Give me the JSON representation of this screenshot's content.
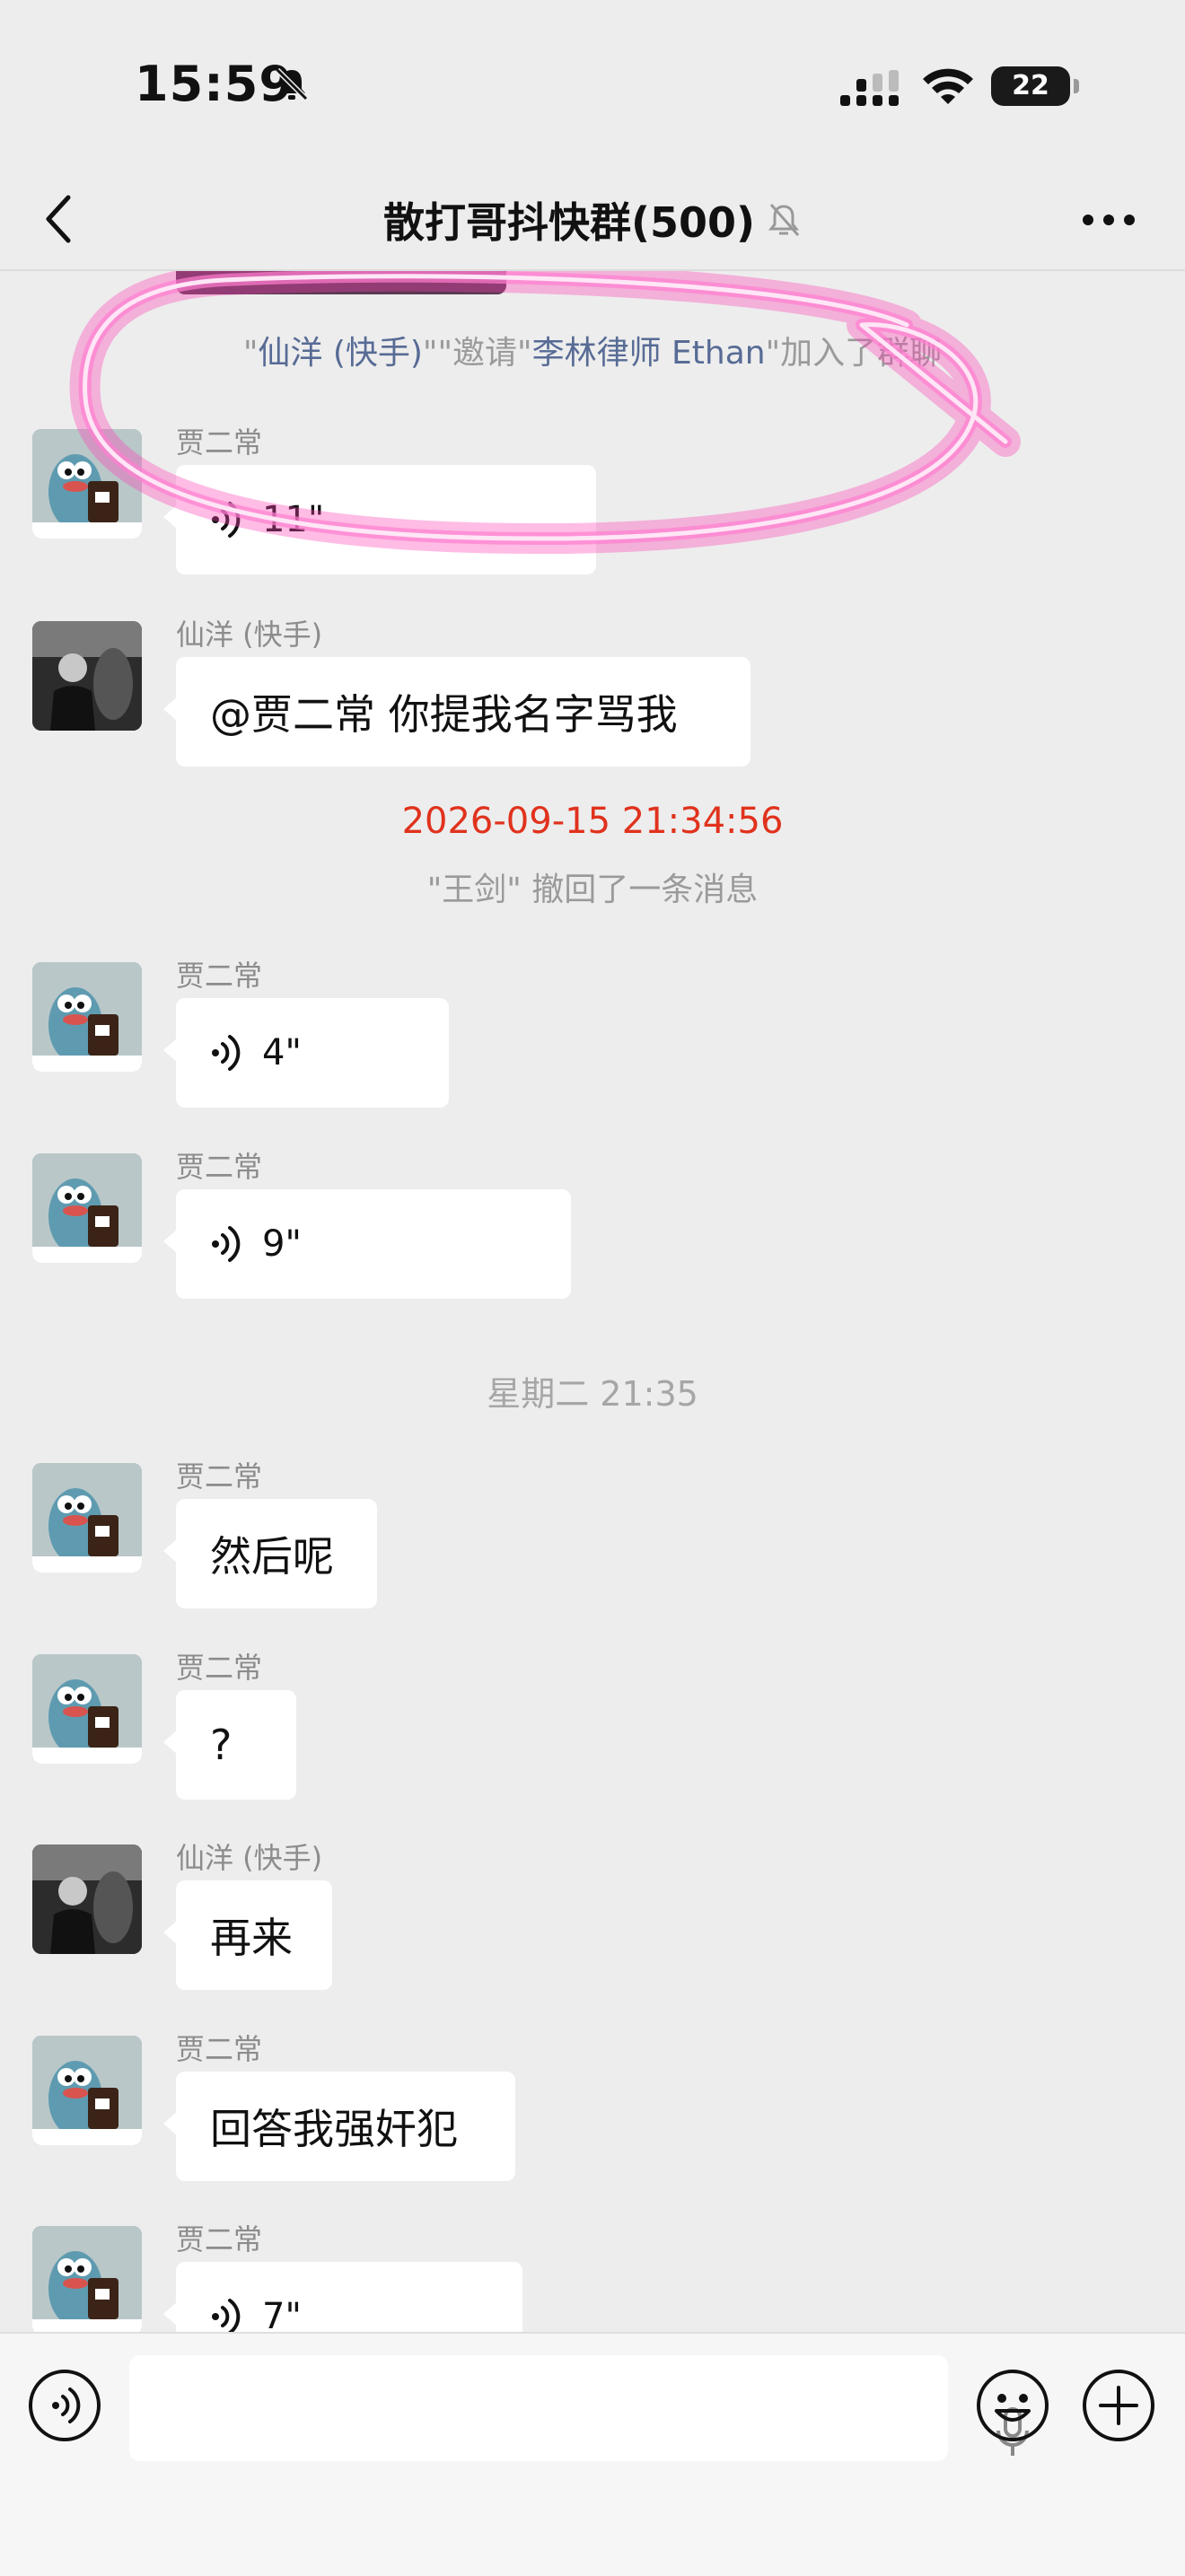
{
  "status_bar": {
    "time": "15:59",
    "battery": "22"
  },
  "nav": {
    "title": "散打哥抖快群(500)"
  },
  "chat": {
    "system_invite": {
      "q1": "\"",
      "inviter": "仙洋 (快手)",
      "q2": "\"",
      "verb": "\"邀请\"",
      "invitee": "李林律师 Ethan",
      "tail": "\"加入了群聊"
    },
    "timestamp_1": "2026-09-15 21:34:56",
    "recall_notice": "\"王剑\" 撤回了一条消息",
    "timestamp_2": "星期二 21:35",
    "messages": [
      {
        "sender": "贾二常",
        "type": "voice",
        "text": "11\""
      },
      {
        "sender": "仙洋 (快手)",
        "type": "text",
        "text": "@贾二常 你提我名字骂我"
      },
      {
        "sender": "贾二常",
        "type": "voice",
        "text": "4\""
      },
      {
        "sender": "贾二常",
        "type": "voice",
        "text": "9\""
      },
      {
        "sender": "贾二常",
        "type": "text",
        "text": "然后呢"
      },
      {
        "sender": "贾二常",
        "type": "text",
        "text": "?"
      },
      {
        "sender": "仙洋 (快手)",
        "type": "text",
        "text": "再来"
      },
      {
        "sender": "贾二常",
        "type": "text",
        "text": "回答我强奸犯"
      },
      {
        "sender": "贾二常",
        "type": "voice",
        "text": "7\""
      }
    ]
  },
  "input": {
    "placeholder": ""
  },
  "colors": {
    "link": "#576b95",
    "timestamp_red": "#e0321d",
    "highlight": "#ff3fb4",
    "background": "#ededed"
  }
}
